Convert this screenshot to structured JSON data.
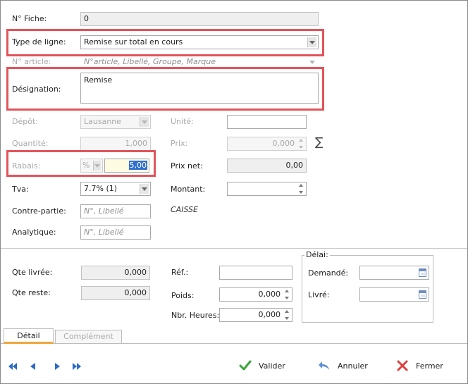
{
  "form": {
    "fiche": {
      "label": "N° Fiche:",
      "value": "0"
    },
    "type_ligne": {
      "label": "Type de ligne:",
      "value": "Remise sur total en cours"
    },
    "article": {
      "label": "N° article:",
      "placeholder": "N°article, Libellé, Groupe, Marque"
    },
    "designation": {
      "label": "Désignation:",
      "value": "Remise"
    },
    "depot": {
      "label": "Dépôt:",
      "value": "Lausanne"
    },
    "unite": {
      "label": "Unité:",
      "value": ""
    },
    "quantite": {
      "label": "Quantité:",
      "value": "1,000"
    },
    "prix": {
      "label": "Prix:",
      "value": "0,000"
    },
    "sum_symbol": "∑",
    "rabais": {
      "label": "Rabais:",
      "unit": "%",
      "value": "5,00"
    },
    "prix_net": {
      "label": "Prix net:",
      "value": "0,00"
    },
    "tva": {
      "label": "Tva:",
      "value": "7.7% (1)"
    },
    "montant": {
      "label": "Montant:",
      "value": ""
    },
    "contre_partie": {
      "label": "Contre-partie:",
      "placeholder": "N°, Libellé"
    },
    "caisse": "CAISSE",
    "analytique": {
      "label": "Analytique:",
      "placeholder": "N°, Libellé"
    }
  },
  "lower": {
    "qte_livree": {
      "label": "Qte livrée:",
      "value": "0,000"
    },
    "qte_reste": {
      "label": "Qte reste:",
      "value": "0,000"
    },
    "ref": {
      "label": "Réf.:",
      "value": ""
    },
    "poids": {
      "label": "Poids:",
      "value": "0,000"
    },
    "nbr_heures": {
      "label": "Nbr. Heures:",
      "value": "0,000"
    },
    "delai": {
      "title": "Délai:",
      "demande": {
        "label": "Demandé:",
        "value": ""
      },
      "livre": {
        "label": "Livré:",
        "value": ""
      }
    }
  },
  "tabs": [
    {
      "label": "Détail",
      "active": true
    },
    {
      "label": "Complément",
      "active": false
    }
  ],
  "actions": {
    "valider": "Valider",
    "annuler": "Annuler",
    "fermer": "Fermer"
  },
  "colors": {
    "highlight_box": "#e2545a",
    "tab_accent": "#f0a53b",
    "nav_blue": "#2d6bc4",
    "check_green": "#3aa53a",
    "cross_red": "#e04040"
  }
}
